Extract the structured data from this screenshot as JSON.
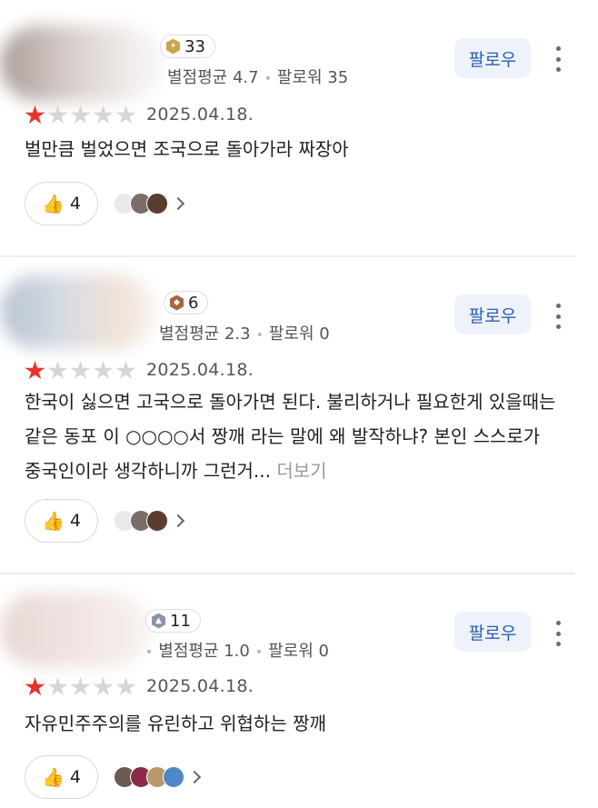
{
  "colors": {
    "accent": "#2a5db0",
    "star_on": "#e8322b",
    "star_off": "#d6d6d6",
    "follow_bg": "#eef3fb"
  },
  "reviews": [
    {
      "badge_count": "33",
      "badge_icon": "diamond-badge-icon",
      "rating_avg_label": "별점평균 4.7",
      "followers_label": "팔로워 35",
      "follow_label": "팔로우",
      "rating": 1,
      "rating_max": 5,
      "date": "2025.04.18.",
      "text": "벌만큼 벌었으면 조국으로 돌아가라 짜장아",
      "more_label": "",
      "likes": "4"
    },
    {
      "badge_count": "6",
      "badge_icon": "bronze-badge-icon",
      "rating_avg_label": "별점평균 2.3",
      "followers_label": "팔로워 0",
      "follow_label": "팔로우",
      "rating": 1,
      "rating_max": 5,
      "date": "2025.04.18.",
      "text": "한국이 싫으면 고국으로 돌아가면 된다. 불리하거나 필요한게 있을때는 같은 동포 이 ○○○○서 짱깨 라는 말에 왜 발작하냐? 본인 스스로가 중국인이라 생각하니까 그런거... ",
      "more_label": "더보기",
      "likes": "4"
    },
    {
      "badge_count": "11",
      "badge_icon": "silver-badge-icon",
      "rating_avg_label": "별점평균 1.0",
      "followers_label": "팔로워 0",
      "follow_label": "팔로우",
      "rating": 1,
      "rating_max": 5,
      "date": "2025.04.18.",
      "text": "자유민주주의를 유린하고 위협하는 짱깨",
      "more_label": "",
      "likes": "4"
    }
  ]
}
